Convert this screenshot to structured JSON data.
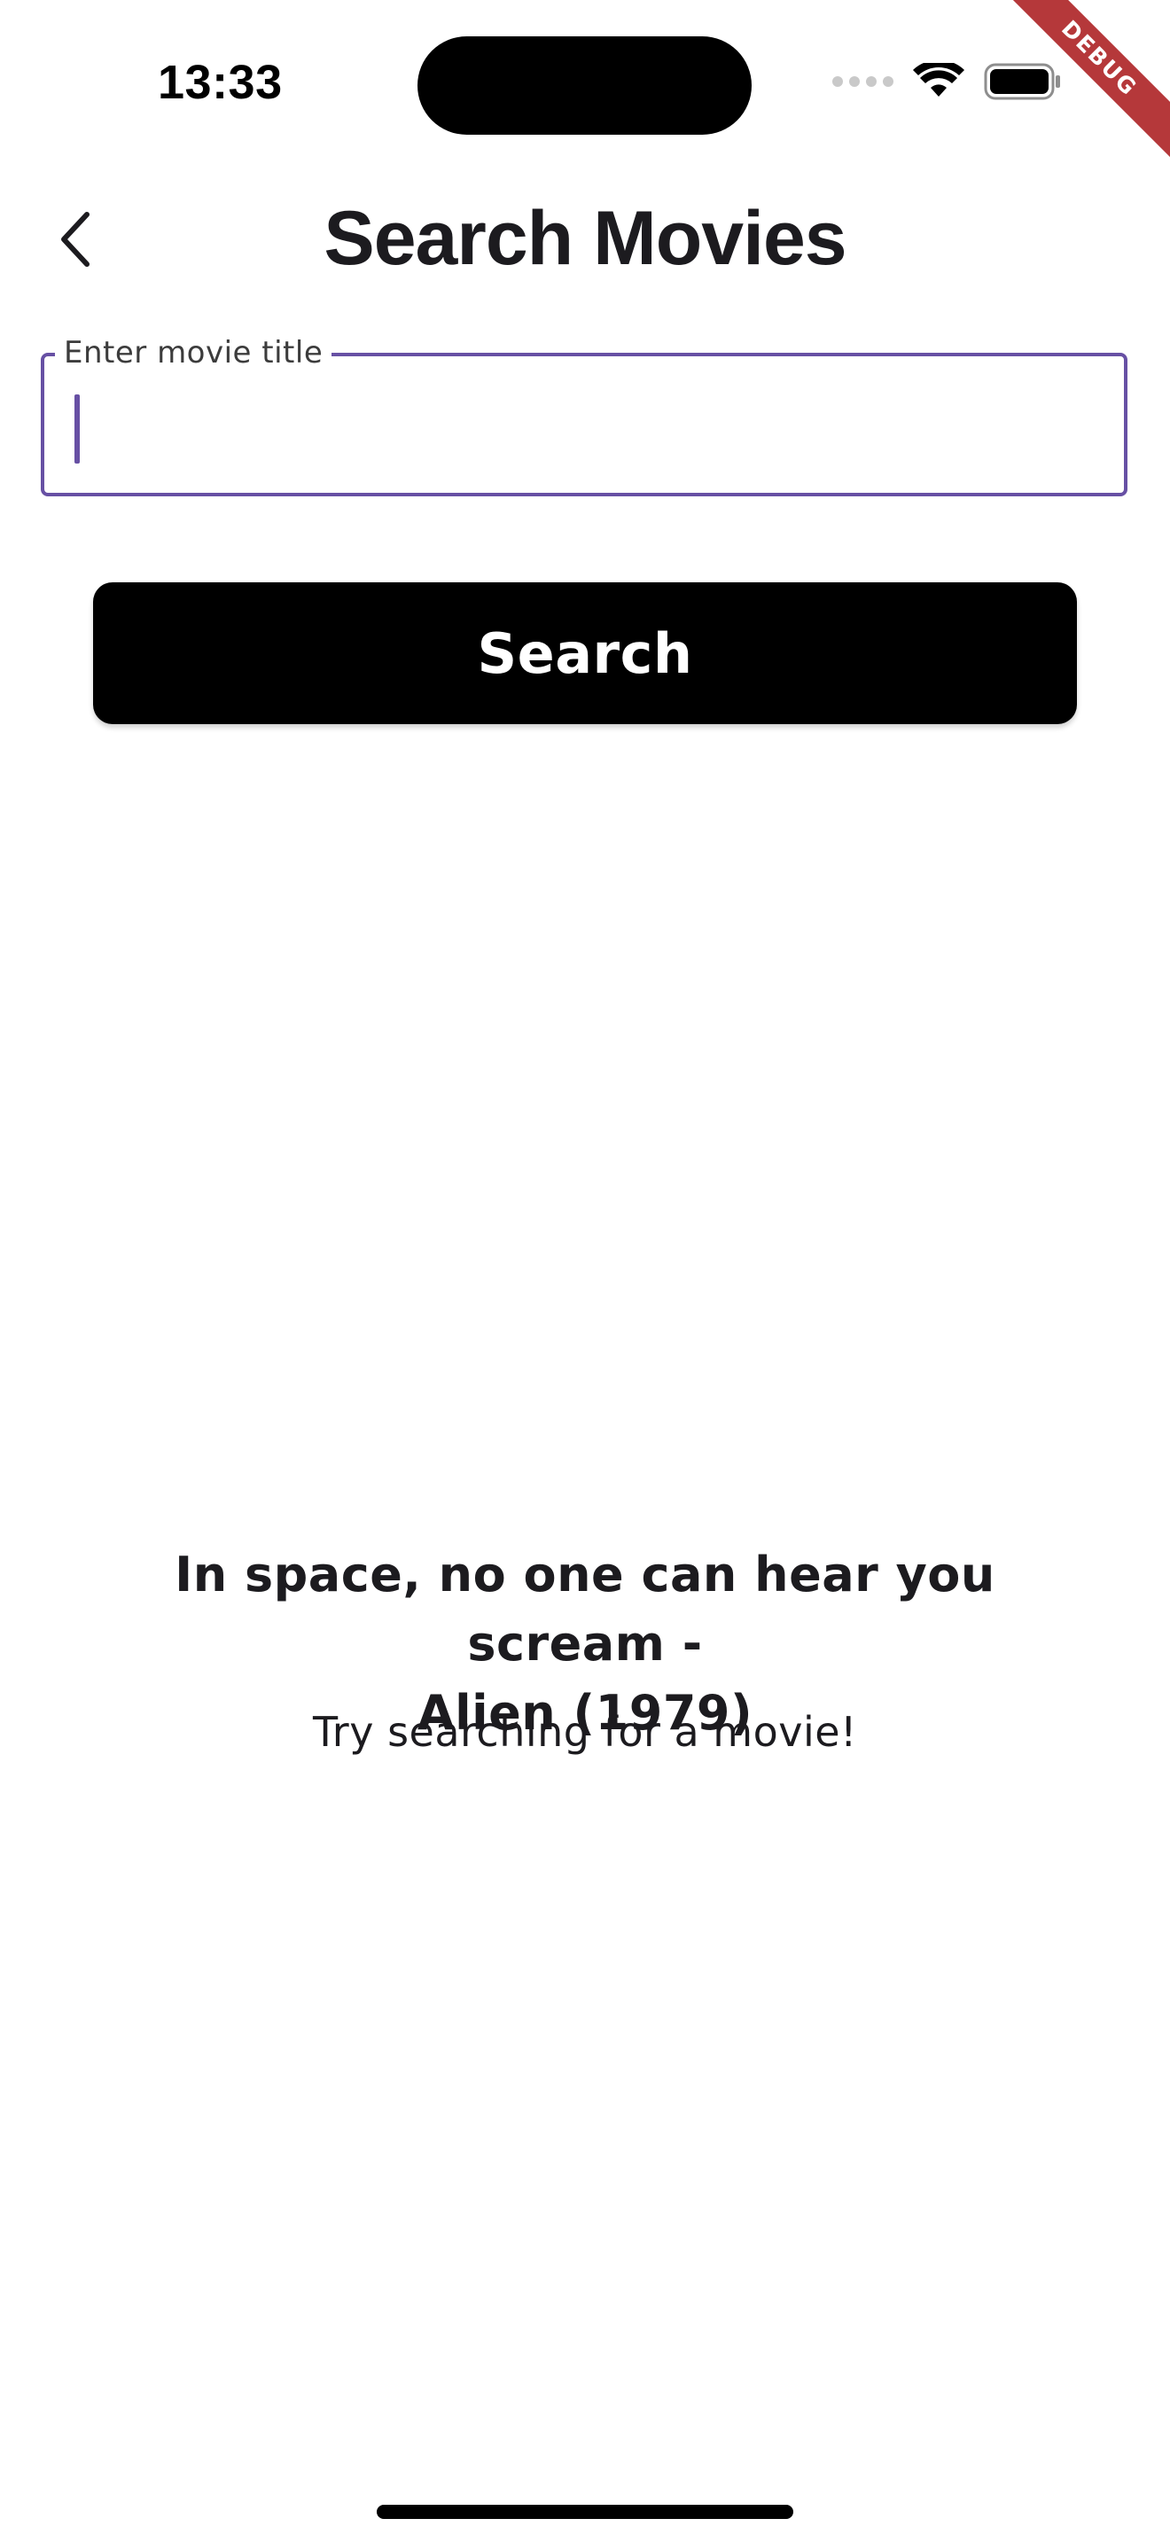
{
  "status_bar": {
    "time": "13:33",
    "icons": [
      "cellular-dots-icon",
      "wifi-icon",
      "battery-icon"
    ]
  },
  "debug_banner": {
    "label": "DEBUG",
    "color": "#b5383a"
  },
  "app_bar": {
    "back_icon": "chevron-left-icon",
    "title": "Search Movies"
  },
  "search_field": {
    "label": "Enter movie title",
    "value": "",
    "accent_color": "#6750a4"
  },
  "search_button": {
    "label": "Search",
    "background": "#000000"
  },
  "empty_state": {
    "quote_line1": "In space, no one can hear you scream -",
    "quote_line2": "Alien (1979)",
    "hint": "Try searching for a movie!"
  }
}
